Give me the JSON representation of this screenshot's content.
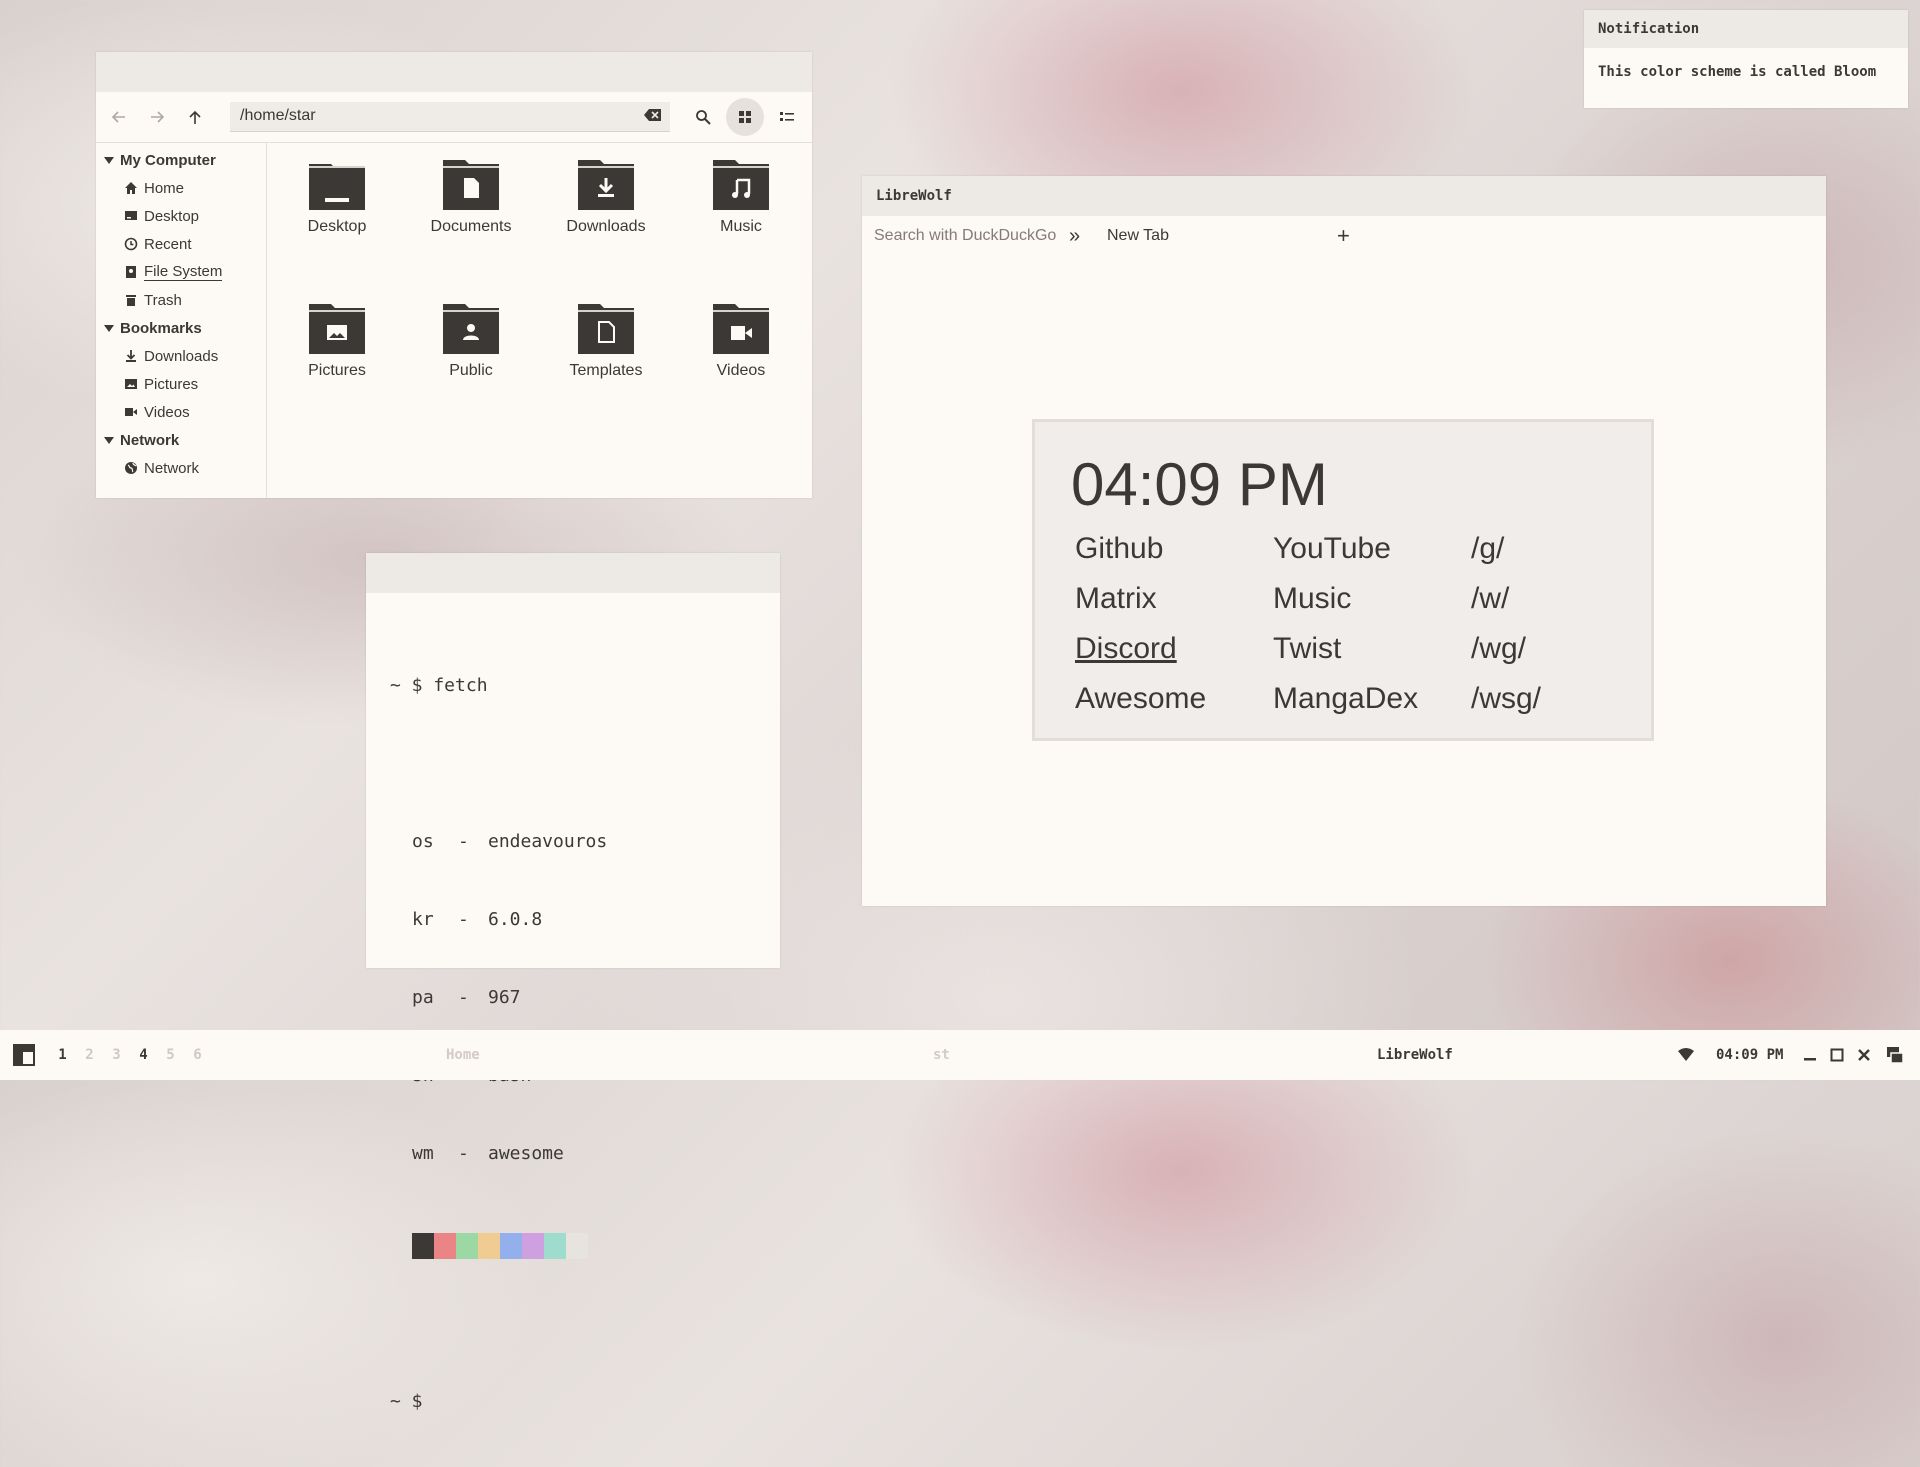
{
  "colors": {
    "accent": "#3c3836",
    "bg": "#fdf9f5",
    "titlebar": "#ede9e5"
  },
  "notification": {
    "title": "Notification",
    "body": "This color scheme is called Bloom"
  },
  "file_manager": {
    "path": "/home/star",
    "sidebar": [
      {
        "section": "My Computer",
        "items": [
          {
            "label": "Home",
            "icon": "home-icon"
          },
          {
            "label": "Desktop",
            "icon": "desktop-icon"
          },
          {
            "label": "Recent",
            "icon": "recent-icon"
          },
          {
            "label": "File System",
            "icon": "drive-icon"
          },
          {
            "label": "Trash",
            "icon": "trash-icon"
          }
        ]
      },
      {
        "section": "Bookmarks",
        "items": [
          {
            "label": "Downloads",
            "icon": "download-icon"
          },
          {
            "label": "Pictures",
            "icon": "image-icon"
          },
          {
            "label": "Videos",
            "icon": "video-icon"
          }
        ]
      },
      {
        "section": "Network",
        "items": [
          {
            "label": "Network",
            "icon": "globe-icon"
          }
        ]
      }
    ],
    "folders": [
      {
        "label": "Desktop",
        "icon": "folder-desktop-icon"
      },
      {
        "label": "Documents",
        "icon": "folder-documents-icon"
      },
      {
        "label": "Downloads",
        "icon": "folder-downloads-icon"
      },
      {
        "label": "Music",
        "icon": "folder-music-icon"
      },
      {
        "label": "Pictures",
        "icon": "folder-pictures-icon"
      },
      {
        "label": "Public",
        "icon": "folder-public-icon"
      },
      {
        "label": "Templates",
        "icon": "folder-templates-icon"
      },
      {
        "label": "Videos",
        "icon": "folder-videos-icon"
      }
    ]
  },
  "browser": {
    "title": "LibreWolf",
    "search_placeholder": "Search with DuckDuckGo",
    "tab_label": "New Tab",
    "new_tab_symbol": "+",
    "overflow_symbol": "»",
    "startpage": {
      "time": "04:09 PM",
      "links": [
        [
          "Github",
          "YouTube",
          "/g/"
        ],
        [
          "Matrix",
          "Music",
          "/w/"
        ],
        [
          "Discord",
          "Twist",
          "/wg/"
        ],
        [
          "Awesome",
          "MangaDex",
          "/wsg/"
        ]
      ]
    }
  },
  "terminal": {
    "command_line": "~ $ fetch",
    "info": [
      {
        "key": "os",
        "value": "endeavouros"
      },
      {
        "key": "kr",
        "value": "6.0.8"
      },
      {
        "key": "pa",
        "value": "967"
      },
      {
        "key": "sh",
        "value": "bash"
      },
      {
        "key": "wm",
        "value": "awesome"
      }
    ],
    "dash": "-",
    "palette": [
      "#3c3836",
      "#ea8485",
      "#9bd8a4",
      "#f0cb92",
      "#93b0ec",
      "#cfa0df",
      "#9edcce",
      "#e7e3df"
    ],
    "prompt": "~ $"
  },
  "taskbar": {
    "workspaces": [
      "1",
      "2",
      "3",
      "4",
      "5",
      "6"
    ],
    "tasks": [
      "Home",
      "st",
      "LibreWolf"
    ],
    "clock": "04:09 PM"
  }
}
